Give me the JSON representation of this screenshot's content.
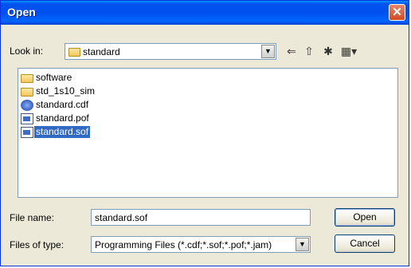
{
  "window": {
    "title": "Open"
  },
  "lookin": {
    "label": "Look in:",
    "value": "standard"
  },
  "toolbar": {
    "back_icon": "back-arrow-icon",
    "up_icon": "up-folder-icon",
    "new_folder_icon": "new-folder-icon",
    "view_icon": "view-menu-icon"
  },
  "files": [
    {
      "name": "software",
      "icon": "folder-icon"
    },
    {
      "name": "std_1s10_sim",
      "icon": "folder-icon"
    },
    {
      "name": "standard.cdf",
      "icon": "cdf-icon"
    },
    {
      "name": "standard.pof",
      "icon": "pof-file-icon"
    },
    {
      "name": "standard.sof",
      "icon": "sof-file-icon",
      "selected": true
    }
  ],
  "filename": {
    "label": "File name:",
    "value": "standard.sof"
  },
  "filetype": {
    "label": "Files of type:",
    "value": "Programming Files (*.cdf;*.sof;*.pof;*.jam)"
  },
  "buttons": {
    "open": "Open",
    "cancel": "Cancel"
  },
  "colors": {
    "selection": "#316ac5",
    "titlebar": "#0053ee",
    "dialog_bg": "#ece9d8"
  }
}
